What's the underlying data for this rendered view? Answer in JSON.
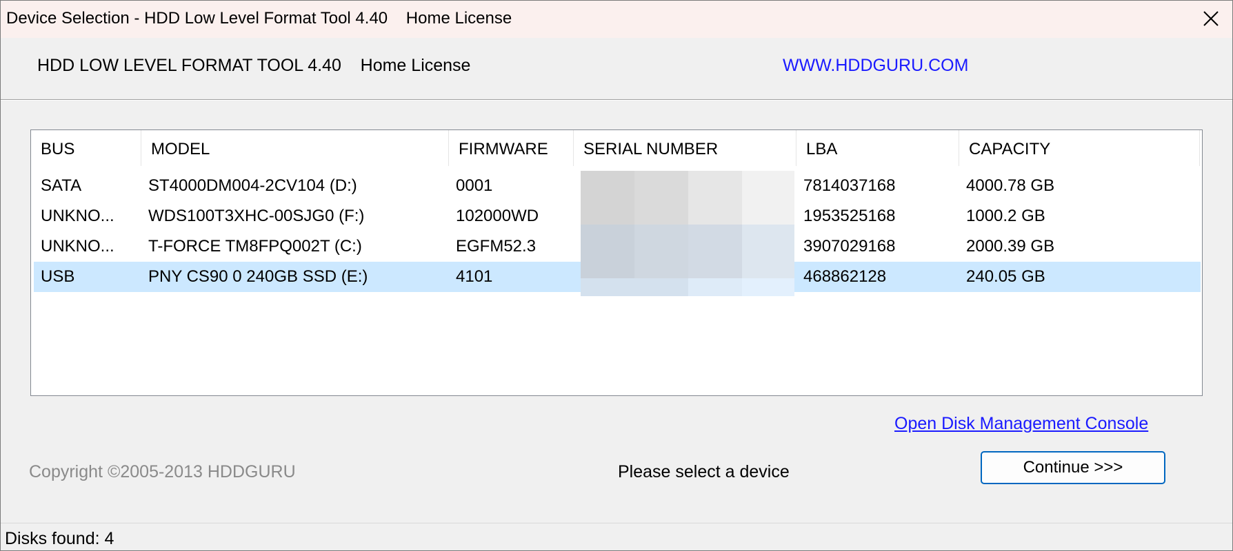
{
  "window": {
    "title": "Device Selection - HDD Low Level Format Tool 4.40    Home License",
    "close_glyph": "✕"
  },
  "header": {
    "app_name": "HDD LOW LEVEL FORMAT TOOL 4.40    Home License",
    "website": "WWW.HDDGURU.COM",
    "website_color": "#1a1aff"
  },
  "table": {
    "columns": [
      "BUS",
      "MODEL",
      "FIRMWARE",
      "SERIAL NUMBER",
      "LBA",
      "CAPACITY"
    ],
    "rows": [
      {
        "bus": "SATA",
        "model": "ST4000DM004-2CV104 (D:)",
        "firmware": "0001",
        "serial": "",
        "lba": "7814037168",
        "capacity": "4000.78 GB",
        "selected": false
      },
      {
        "bus": "UNKNO...",
        "model": "WDS100T3XHC-00SJG0 (F:)",
        "firmware": "102000WD",
        "serial": "",
        "lba": "1953525168",
        "capacity": "1000.2 GB",
        "selected": false
      },
      {
        "bus": "UNKNO...",
        "model": "T-FORCE TM8FPQ002T (C:)",
        "firmware": "EGFM52.3",
        "serial": "",
        "lba": "3907029168",
        "capacity": "2000.39 GB",
        "selected": false
      },
      {
        "bus": "USB",
        "model": "PNY CS90 0 240GB SSD (E:)",
        "firmware": "4101",
        "serial": "",
        "lba": "468862128",
        "capacity": "240.05 GB",
        "selected": true
      }
    ],
    "selection_color": "#cce8ff"
  },
  "footer": {
    "disk_management_link": "Open Disk Management Console",
    "copyright": "Copyright ©2005-2013 HDDGURU",
    "status_message": "Please select a device",
    "continue_label": "Continue >>>"
  },
  "statusbar": {
    "text": "Disks found: 4"
  }
}
